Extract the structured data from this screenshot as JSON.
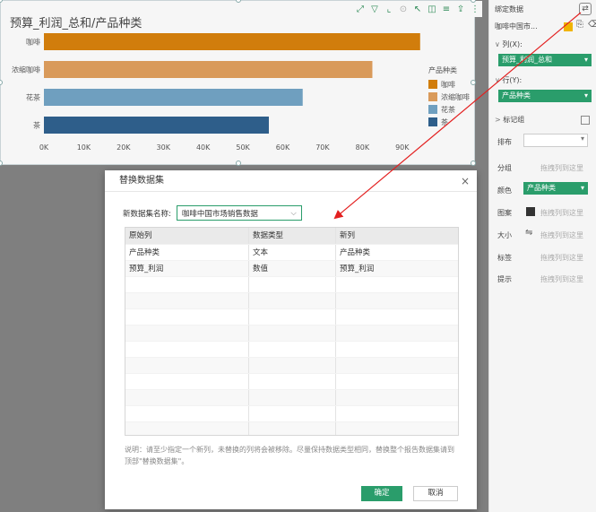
{
  "chart": {
    "title": "预算_利润_总和/产品种类",
    "legend_title": "产品种类"
  },
  "chart_data": {
    "type": "bar",
    "orientation": "horizontal",
    "title": "预算_利润_总和/产品种类",
    "categories": [
      "咖啡",
      "浓缩咖啡",
      "花茶",
      "茶"
    ],
    "values": [
      94500,
      82500,
      65000,
      56500
    ],
    "colors": [
      "#d17d0c",
      "#d99a5a",
      "#6f9fbf",
      "#2e5e8a"
    ],
    "xlim": [
      0,
      95000
    ],
    "x_ticks": [
      "0K",
      "10K",
      "20K",
      "30K",
      "40K",
      "50K",
      "60K",
      "70K",
      "80K",
      "90K"
    ],
    "x_tick_values": [
      0,
      10000,
      20000,
      30000,
      40000,
      50000,
      60000,
      70000,
      80000,
      90000
    ],
    "legend": {
      "title": "产品种类",
      "items": [
        "咖啡",
        "浓缩咖啡",
        "花茶",
        "茶"
      ],
      "placement": "right"
    }
  },
  "panel": {
    "bind_data": "绑定数据",
    "dataset_name": "咖啡中国市...",
    "col_label": "列(X):",
    "col_value": "预算_利润_总和",
    "row_label": "行(Y):",
    "row_value": "产品种类",
    "mark_group": "标记组",
    "sort_label": "排布",
    "group_label": "分组",
    "group_hint": "拖拽列到这里",
    "color_label": "颜色",
    "color_value": "产品种类",
    "image_label": "图案",
    "image_hint": "拖拽列到这里",
    "size_label": "大小",
    "size_hint": "拖拽列到这里",
    "tag_label": "标签",
    "tag_hint": "拖拽列到这里",
    "tip_label": "提示",
    "tip_hint": "拖拽列到这里"
  },
  "dialog": {
    "title": "替换数据集",
    "close": "×",
    "dataset_label": "新数据集名称:",
    "dataset_value": "咖啡中国市场销售数据",
    "columns": [
      "原始列",
      "数据类型",
      "新列"
    ],
    "rows": [
      [
        "产品种类",
        "文本",
        "产品种类"
      ],
      [
        "预算_利润",
        "数值",
        "预算_利润"
      ]
    ],
    "note": "说明：请至少指定一个新列，未替换的列将会被移除。尽量保持数据类型相同，替换整个报告数据集请到顶部\"替换数据集\"。",
    "ok": "确定",
    "cancel": "取消"
  },
  "colors": {
    "accent": "#2a9d6b",
    "arrow": "#e32020"
  }
}
